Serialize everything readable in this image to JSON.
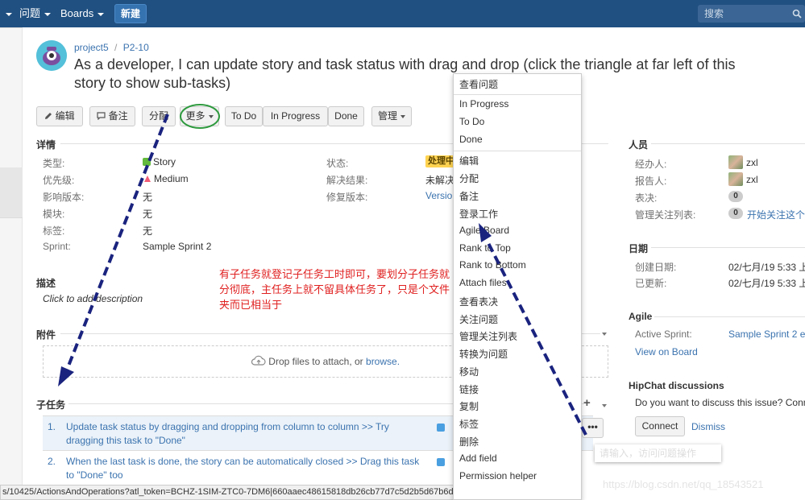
{
  "nav": {
    "issues": "问题",
    "boards": "Boards",
    "create": "新建",
    "search_placeholder": "搜索"
  },
  "breadcrumb": {
    "project": "project5",
    "separator": "/",
    "issue_key": "P2-10"
  },
  "summary": "As a developer, I can update story and task status with drag and drop (click the triangle at far left of this story to show sub-tasks)",
  "toolbar": {
    "edit": "编辑",
    "comment": "备注",
    "assign": "分配",
    "more": "更多",
    "todo": "To Do",
    "in_progress": "In Progress",
    "done": "Done",
    "admin": "管理"
  },
  "details": {
    "title": "详情",
    "type_label": "类型:",
    "type_value": "Story",
    "priority_label": "优先级:",
    "priority_value": "Medium",
    "affects_label": "影响版本:",
    "affects_value": "无",
    "module_label": "模块:",
    "module_value": "无",
    "labels_label": "标签:",
    "labels_value": "无",
    "sprint_label": "Sprint:",
    "sprint_value": "Sample Sprint 2",
    "status_label": "状态:",
    "status_value": "处理中",
    "resolution_label": "解决结果:",
    "resolution_value": "未解决",
    "fix_label": "修复版本:",
    "fix_value": "Versio"
  },
  "description": {
    "title": "描述",
    "placeholder": "Click to add description"
  },
  "annotation": "有子任务就登记子任务工时即可，要划分子任务就分彻底，主任务上就不留具体任务了，只是个文件夹而已相当于",
  "attachments": {
    "title": "附件",
    "drop_text": "Drop files to attach, or ",
    "browse": "browse."
  },
  "subtasks": {
    "title": "子任务",
    "items": [
      {
        "num": "1.",
        "text": "Update task status by dragging and dropping from column to column >> Try dragging this task to \"Done\""
      },
      {
        "num": "2.",
        "text": "When the last task is done, the story can be automatically closed >> Drag this task to \"Done\" too"
      }
    ],
    "more_button": "•••",
    "tooltip": "请输入，访问问题操作"
  },
  "dropdown": {
    "items": [
      "查看问题",
      "In Progress",
      "To Do",
      "Done",
      "编辑",
      "分配",
      "备注",
      "登录工作",
      "Agile Board",
      "Rank to Top",
      "Rank to Bottom",
      "Attach files",
      "查看表决",
      "关注问题",
      "管理关注列表",
      "转换为问题",
      "移动",
      "链接",
      "复制",
      "标签",
      "删除",
      "Add field",
      "Permission helper"
    ]
  },
  "people": {
    "title": "人员",
    "assignee_label": "经办人:",
    "assignee_value": "zxl",
    "reporter_label": "报告人:",
    "reporter_value": "zxl",
    "votes_label": "表决:",
    "votes_value": "0",
    "watchers_label": "管理关注列表:",
    "watchers_value": "0",
    "watch_link": "开始关注这个"
  },
  "dates": {
    "title": "日期",
    "created_label": "创建日期:",
    "created_value": "02/七月/19 5:33 上",
    "updated_label": "已更新:",
    "updated_value": "02/七月/19 5:33 上"
  },
  "agile": {
    "title": "Agile",
    "sprint_label": "Active Sprint:",
    "sprint_value": "Sample Sprint 2 e",
    "board_link": "View on Board"
  },
  "hipchat": {
    "title": "HipChat discussions",
    "text": "Do you want to discuss this issue? Conn",
    "connect": "Connect",
    "dismiss": "Dismiss"
  },
  "statusbar": "s/10425/ActionsAndOperations?atl_token=BCHZ-1SIM-ZTC0-7DM6|660aaec48615818db26cb77d7c5d2b5d67b6d93|lin",
  "watermark": "https://blog.csdn.net/qq_18543521",
  "colors": {
    "nav": "#205081",
    "link": "#3b73af",
    "annotation": "#e02020",
    "arrow": "#1a237e",
    "ellipse": "#2e9a3e"
  }
}
